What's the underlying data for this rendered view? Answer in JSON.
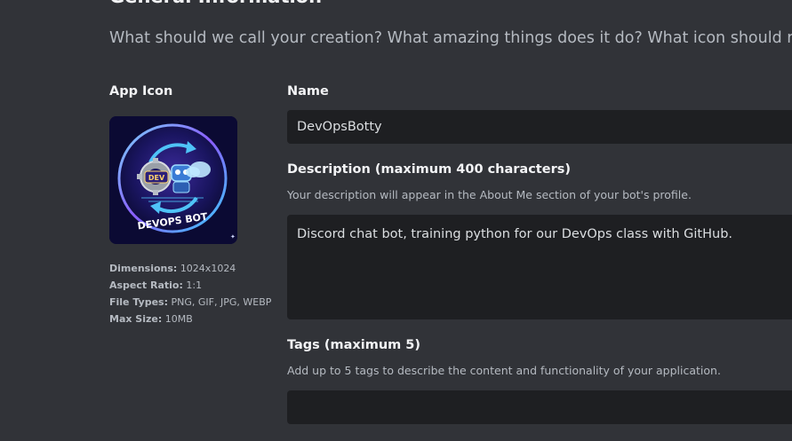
{
  "header": {
    "title": "General Information",
    "subtitle": "What should we call your creation? What amazing things does it do? What icon should represent it across Discord? Tell us here!"
  },
  "app_icon": {
    "label": "App Icon",
    "image_text": "DEVOPS BOT",
    "badge_text": "DEV",
    "icon_name": "devops-bot-logo",
    "meta": [
      {
        "key": "Dimensions:",
        "value": "1024x1024"
      },
      {
        "key": "Aspect Ratio:",
        "value": "1:1"
      },
      {
        "key": "File Types:",
        "value": "PNG, GIF, JPG, WEBP"
      },
      {
        "key": "Max Size:",
        "value": "10MB"
      }
    ]
  },
  "name_field": {
    "label": "Name",
    "value": "DevOpsBotty"
  },
  "description_field": {
    "label": "Description (maximum 400 characters)",
    "help": "Your description will appear in the About Me section of your bot's profile.",
    "value": "Discord chat bot, training python for our DevOps class with GitHub."
  },
  "tags_field": {
    "label": "Tags (maximum 5)",
    "help": "Add up to 5 tags to describe the content and functionality of your application.",
    "value": ""
  },
  "colors": {
    "background": "#313338",
    "input_background": "#1e1f22",
    "text_primary": "#f2f3f5",
    "text_muted": "#b5bac1"
  }
}
